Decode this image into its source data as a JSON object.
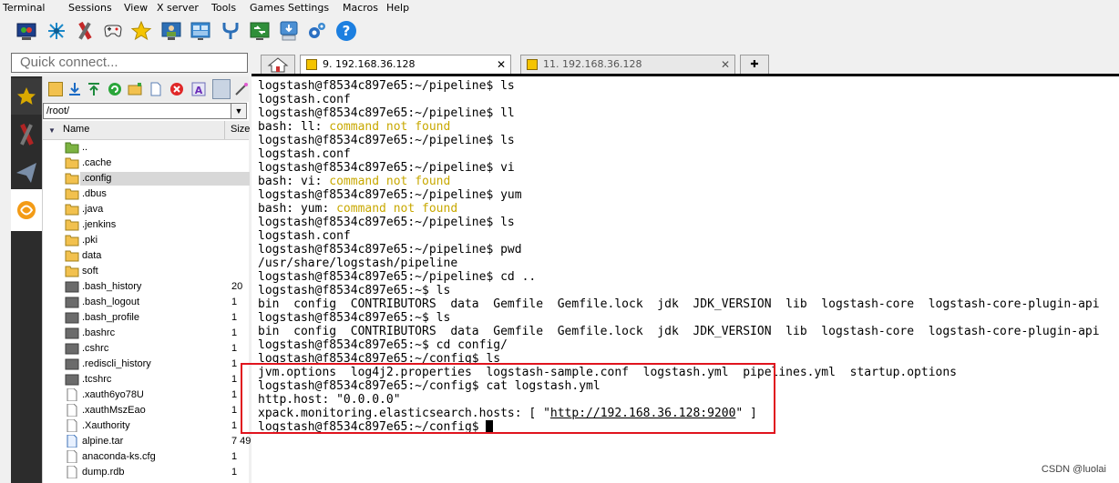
{
  "menu": {
    "items": [
      "Terminal",
      "Sessions",
      "View",
      "X server",
      "Tools",
      "Games",
      "Settings",
      "Macros",
      "Help"
    ]
  },
  "toolbar": {
    "icons": [
      "session-icon",
      "servers-icon",
      "tools-icon",
      "games-icon",
      "favorites-icon",
      "sessions-icon",
      "view-icon",
      "split-icon",
      "multiexec-icon",
      "tunneling-icon",
      "packages-icon",
      "settings-icon",
      "help-icon"
    ]
  },
  "quick_connect": {
    "placeholder": "Quick connect..."
  },
  "tabs": [
    {
      "label": "",
      "kind": "home"
    },
    {
      "label": "9. 192.168.36.128",
      "active": true
    },
    {
      "label": "11. 192.168.36.128",
      "active": false
    }
  ],
  "file_browser": {
    "path": "/root/",
    "columns": {
      "name": "Name",
      "size": "Size"
    },
    "rows": [
      {
        "name": "..",
        "size": "",
        "icon": "parent-folder-icon"
      },
      {
        "name": ".cache",
        "size": "",
        "icon": "folder-icon"
      },
      {
        "name": ".config",
        "size": "",
        "icon": "folder-icon",
        "selected": true
      },
      {
        "name": ".dbus",
        "size": "",
        "icon": "folder-icon"
      },
      {
        "name": ".java",
        "size": "",
        "icon": "folder-icon"
      },
      {
        "name": ".jenkins",
        "size": "",
        "icon": "folder-icon"
      },
      {
        "name": ".pki",
        "size": "",
        "icon": "folder-icon"
      },
      {
        "name": "data",
        "size": "",
        "icon": "folder-icon"
      },
      {
        "name": "soft",
        "size": "",
        "icon": "folder-icon"
      },
      {
        "name": ".bash_history",
        "size": "20",
        "icon": "file-icon"
      },
      {
        "name": ".bash_logout",
        "size": "1",
        "icon": "file-icon"
      },
      {
        "name": ".bash_profile",
        "size": "1",
        "icon": "file-icon"
      },
      {
        "name": ".bashrc",
        "size": "1",
        "icon": "file-icon"
      },
      {
        "name": ".cshrc",
        "size": "1",
        "icon": "file-icon"
      },
      {
        "name": ".rediscli_history",
        "size": "1",
        "icon": "file-icon"
      },
      {
        "name": ".tcshrc",
        "size": "1",
        "icon": "file-icon"
      },
      {
        "name": ".xauth6yo78U",
        "size": "1",
        "icon": "doc-icon"
      },
      {
        "name": ".xauthMszEao",
        "size": "1",
        "icon": "doc-icon"
      },
      {
        "name": ".Xauthority",
        "size": "1",
        "icon": "doc-icon"
      },
      {
        "name": "alpine.tar",
        "size": "7 49",
        "icon": "archive-icon"
      },
      {
        "name": "anaconda-ks.cfg",
        "size": "1",
        "icon": "doc-icon"
      },
      {
        "name": "dump.rdb",
        "size": "1",
        "icon": "doc-icon"
      }
    ]
  },
  "terminal": {
    "lines": [
      {
        "text": "logstash@f8534c897e65:~/pipeline$ ls"
      },
      {
        "text": "logstash.conf"
      },
      {
        "text": "logstash@f8534c897e65:~/pipeline$ ll"
      },
      {
        "text": "bash: ll: ",
        "err": "command not found"
      },
      {
        "text": "logstash@f8534c897e65:~/pipeline$ ls"
      },
      {
        "text": "logstash.conf"
      },
      {
        "text": "logstash@f8534c897e65:~/pipeline$ vi"
      },
      {
        "text": "bash: vi: ",
        "err": "command not found"
      },
      {
        "text": "logstash@f8534c897e65:~/pipeline$ yum"
      },
      {
        "text": "bash: yum: ",
        "err": "command not found"
      },
      {
        "text": "logstash@f8534c897e65:~/pipeline$ ls"
      },
      {
        "text": "logstash.conf"
      },
      {
        "text": "logstash@f8534c897e65:~/pipeline$ pwd"
      },
      {
        "text": "/usr/share/logstash/pipeline"
      },
      {
        "text": "logstash@f8534c897e65:~/pipeline$ cd .."
      },
      {
        "text": "logstash@f8534c897e65:~$ ls"
      },
      {
        "text": "bin  config  CONTRIBUTORS  data  Gemfile  Gemfile.lock  jdk  JDK_VERSION  lib  logstash-core  logstash-core-plugin-api"
      },
      {
        "text": "logstash@f8534c897e65:~$ ls"
      },
      {
        "text": "bin  config  CONTRIBUTORS  data  Gemfile  Gemfile.lock  jdk  JDK_VERSION  lib  logstash-core  logstash-core-plugin-api"
      },
      {
        "text": "logstash@f8534c897e65:~$ cd config/"
      },
      {
        "text": "logstash@f8534c897e65:~/config$ ls"
      },
      {
        "text": "jvm.options  log4j2.properties  logstash-sample.conf  logstash.yml  pipelines.yml  startup.options"
      },
      {
        "text": "logstash@f8534c897e65:~/config$ cat logstash.yml"
      },
      {
        "text": "http.host: \"0.0.0.0\""
      },
      {
        "text": "xpack.monitoring.elasticsearch.hosts: [ \"",
        "link": "http://192.168.36.128:9200",
        "after": "\" ]"
      },
      {
        "text": "logstash@f8534c897e65:~/config$ ",
        "cursor": true
      }
    ]
  },
  "watermark": "CSDN @luolai",
  "colors": {
    "highlight": "#e0141e",
    "error_text": "#c8a800"
  }
}
